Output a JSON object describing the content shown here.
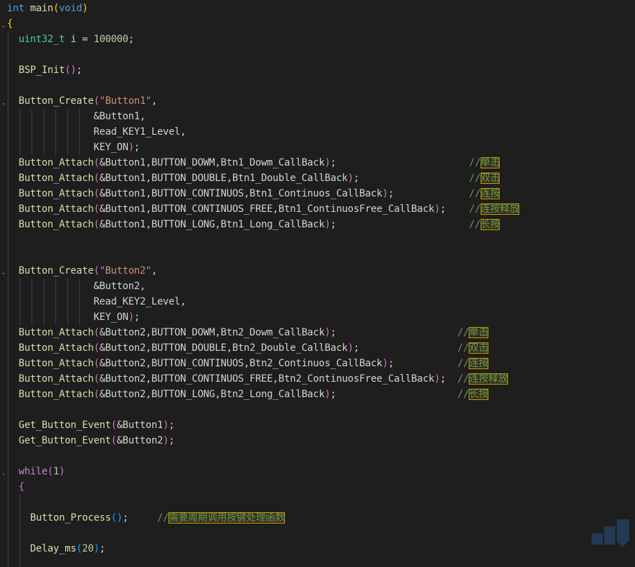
{
  "editor": {
    "language": "c",
    "theme": "dark",
    "colors": {
      "background": "#1e1e1e",
      "keyword": "#569cd6",
      "type": "#4ec9b0",
      "function": "#dcdcaa",
      "control": "#c586c0",
      "string": "#ce9178",
      "number": "#b5cea8",
      "variable": "#9cdcfe",
      "macro": "#4fc1ff",
      "comment": "#6a9955",
      "cjk_highlight_border": "#c8a000"
    },
    "lines": [
      {
        "id": "L1",
        "tokens": [
          {
            "t": "int",
            "c": "kw"
          },
          {
            "t": " ",
            "c": "punc"
          },
          {
            "t": "main",
            "c": "fn"
          },
          {
            "t": "(",
            "c": "p1"
          },
          {
            "t": "void",
            "c": "kw"
          },
          {
            "t": ")",
            "c": "p1"
          }
        ]
      },
      {
        "id": "L2",
        "tokens": [
          {
            "t": "{",
            "c": "p1"
          }
        ]
      },
      {
        "id": "L3",
        "tokens": [
          {
            "t": "  ",
            "c": "punc"
          },
          {
            "t": "uint32_t",
            "c": "ty"
          },
          {
            "t": " ",
            "c": "punc"
          },
          {
            "t": "i",
            "c": "var"
          },
          {
            "t": " = ",
            "c": "punc"
          },
          {
            "t": "100000",
            "c": "num"
          },
          {
            "t": ";",
            "c": "punc"
          }
        ]
      },
      {
        "id": "L4",
        "tokens": []
      },
      {
        "id": "L5",
        "tokens": [
          {
            "t": "  ",
            "c": "punc"
          },
          {
            "t": "BSP_Init",
            "c": "fn"
          },
          {
            "t": "()",
            "c": "p2"
          },
          {
            "t": ";",
            "c": "punc"
          }
        ]
      },
      {
        "id": "L6",
        "tokens": []
      },
      {
        "id": "L7",
        "tokens": [
          {
            "t": "  ",
            "c": "punc"
          },
          {
            "t": "Button_Create",
            "c": "fn"
          },
          {
            "t": "(",
            "c": "p2"
          },
          {
            "t": "\"Button1\"",
            "c": "str"
          },
          {
            "t": ",",
            "c": "punc"
          }
        ]
      },
      {
        "id": "L8",
        "tokens": [
          {
            "t": "               &Button1,",
            "c": "punc"
          }
        ]
      },
      {
        "id": "L9",
        "tokens": [
          {
            "t": "               Read_KEY1_Level,",
            "c": "punc"
          }
        ]
      },
      {
        "id": "L10",
        "tokens": [
          {
            "t": "               KEY_ON",
            "c": "punc"
          },
          {
            "t": ")",
            "c": "p2"
          },
          {
            "t": ";",
            "c": "punc"
          }
        ]
      },
      {
        "id": "L11",
        "tokens": [
          {
            "t": "  ",
            "c": "punc"
          },
          {
            "t": "Button_Attach",
            "c": "fn"
          },
          {
            "t": "(",
            "c": "p2"
          },
          {
            "t": "&Button1,BUTTON_DOWM,Btn1_Dowm_CallBack",
            "c": "punc"
          },
          {
            "t": ")",
            "c": "p2"
          },
          {
            "t": ";",
            "c": "punc"
          },
          {
            "t": "                       ",
            "c": "punc"
          },
          {
            "t": "//",
            "c": "cmt"
          },
          {
            "t": "单击",
            "c": "cjk"
          }
        ]
      },
      {
        "id": "L12",
        "tokens": [
          {
            "t": "  ",
            "c": "punc"
          },
          {
            "t": "Button_Attach",
            "c": "fn"
          },
          {
            "t": "(",
            "c": "p2"
          },
          {
            "t": "&Button1,BUTTON_DOUBLE,Btn1_Double_CallBack",
            "c": "punc"
          },
          {
            "t": ")",
            "c": "p2"
          },
          {
            "t": ";",
            "c": "punc"
          },
          {
            "t": "                   ",
            "c": "punc"
          },
          {
            "t": "//",
            "c": "cmt"
          },
          {
            "t": "双击",
            "c": "cjk"
          }
        ]
      },
      {
        "id": "L13",
        "tokens": [
          {
            "t": "  ",
            "c": "punc"
          },
          {
            "t": "Button_Attach",
            "c": "fn"
          },
          {
            "t": "(",
            "c": "p2"
          },
          {
            "t": "&Button1,BUTTON_CONTINUOS,Btn1_Continuos_CallBack",
            "c": "punc"
          },
          {
            "t": ")",
            "c": "p2"
          },
          {
            "t": ";",
            "c": "punc"
          },
          {
            "t": "             ",
            "c": "punc"
          },
          {
            "t": "//",
            "c": "cmt"
          },
          {
            "t": "连按",
            "c": "cjk"
          }
        ]
      },
      {
        "id": "L14",
        "tokens": [
          {
            "t": "  ",
            "c": "punc"
          },
          {
            "t": "Button_Attach",
            "c": "fn"
          },
          {
            "t": "(",
            "c": "p2"
          },
          {
            "t": "&Button1,BUTTON_CONTINUOS_FREE,Btn1_ContinuosFree_CallBack",
            "c": "punc"
          },
          {
            "t": ")",
            "c": "p2"
          },
          {
            "t": ";",
            "c": "punc"
          },
          {
            "t": "    ",
            "c": "punc"
          },
          {
            "t": "//",
            "c": "cmt"
          },
          {
            "t": "连按释放",
            "c": "cjk"
          }
        ]
      },
      {
        "id": "L15",
        "tokens": [
          {
            "t": "  ",
            "c": "punc"
          },
          {
            "t": "Button_Attach",
            "c": "fn"
          },
          {
            "t": "(",
            "c": "p2"
          },
          {
            "t": "&Button1,BUTTON_LONG,Btn1_Long_CallBack",
            "c": "punc"
          },
          {
            "t": ")",
            "c": "p2"
          },
          {
            "t": ";",
            "c": "punc"
          },
          {
            "t": "                       ",
            "c": "punc"
          },
          {
            "t": "//",
            "c": "cmt"
          },
          {
            "t": "长按",
            "c": "cjk"
          }
        ]
      },
      {
        "id": "L16",
        "tokens": []
      },
      {
        "id": "L17",
        "tokens": []
      },
      {
        "id": "L18",
        "tokens": [
          {
            "t": "  ",
            "c": "punc"
          },
          {
            "t": "Button_Create",
            "c": "fn"
          },
          {
            "t": "(",
            "c": "p2"
          },
          {
            "t": "\"Button2\"",
            "c": "str"
          },
          {
            "t": ",",
            "c": "punc"
          }
        ]
      },
      {
        "id": "L19",
        "tokens": [
          {
            "t": "               &Button2,",
            "c": "punc"
          }
        ]
      },
      {
        "id": "L20",
        "tokens": [
          {
            "t": "               Read_KEY2_Level,",
            "c": "punc"
          }
        ]
      },
      {
        "id": "L21",
        "tokens": [
          {
            "t": "               KEY_ON",
            "c": "punc"
          },
          {
            "t": ")",
            "c": "p2"
          },
          {
            "t": ";",
            "c": "punc"
          }
        ]
      },
      {
        "id": "L22",
        "tokens": [
          {
            "t": "  ",
            "c": "punc"
          },
          {
            "t": "Button_Attach",
            "c": "fn"
          },
          {
            "t": "(",
            "c": "p2"
          },
          {
            "t": "&Button2,BUTTON_DOWM,Btn2_Dowm_CallBack",
            "c": "punc"
          },
          {
            "t": ")",
            "c": "p2"
          },
          {
            "t": ";",
            "c": "punc"
          },
          {
            "t": "                     ",
            "c": "punc"
          },
          {
            "t": "//",
            "c": "cmt"
          },
          {
            "t": "单击",
            "c": "cjk"
          }
        ]
      },
      {
        "id": "L23",
        "tokens": [
          {
            "t": "  ",
            "c": "punc"
          },
          {
            "t": "Button_Attach",
            "c": "fn"
          },
          {
            "t": "(",
            "c": "p2"
          },
          {
            "t": "&Button2,BUTTON_DOUBLE,Btn2_Double_CallBack",
            "c": "punc"
          },
          {
            "t": ")",
            "c": "p2"
          },
          {
            "t": ";",
            "c": "punc"
          },
          {
            "t": "                 ",
            "c": "punc"
          },
          {
            "t": "//",
            "c": "cmt"
          },
          {
            "t": "双击",
            "c": "cjk"
          }
        ]
      },
      {
        "id": "L24",
        "tokens": [
          {
            "t": "  ",
            "c": "punc"
          },
          {
            "t": "Button_Attach",
            "c": "fn"
          },
          {
            "t": "(",
            "c": "p2"
          },
          {
            "t": "&Button2,BUTTON_CONTINUOS,Btn2_Continuos_CallBack",
            "c": "punc"
          },
          {
            "t": ")",
            "c": "p2"
          },
          {
            "t": ";",
            "c": "punc"
          },
          {
            "t": "           ",
            "c": "punc"
          },
          {
            "t": "//",
            "c": "cmt"
          },
          {
            "t": "连按",
            "c": "cjk"
          }
        ]
      },
      {
        "id": "L25",
        "tokens": [
          {
            "t": "  ",
            "c": "punc"
          },
          {
            "t": "Button_Attach",
            "c": "fn"
          },
          {
            "t": "(",
            "c": "p2"
          },
          {
            "t": "&Button2,BUTTON_CONTINUOS_FREE,Btn2_ContinuosFree_CallBack",
            "c": "punc"
          },
          {
            "t": ")",
            "c": "p2"
          },
          {
            "t": ";",
            "c": "punc"
          },
          {
            "t": "  ",
            "c": "punc"
          },
          {
            "t": "//",
            "c": "cmt"
          },
          {
            "t": "连按释放",
            "c": "cjk"
          }
        ]
      },
      {
        "id": "L26",
        "tokens": [
          {
            "t": "  ",
            "c": "punc"
          },
          {
            "t": "Button_Attach",
            "c": "fn"
          },
          {
            "t": "(",
            "c": "p2"
          },
          {
            "t": "&Button2,BUTTON_LONG,Btn2_Long_CallBack",
            "c": "punc"
          },
          {
            "t": ")",
            "c": "p2"
          },
          {
            "t": ";",
            "c": "punc"
          },
          {
            "t": "                     ",
            "c": "punc"
          },
          {
            "t": "//",
            "c": "cmt"
          },
          {
            "t": "长按",
            "c": "cjk"
          }
        ]
      },
      {
        "id": "L27",
        "tokens": []
      },
      {
        "id": "L28",
        "tokens": [
          {
            "t": "  ",
            "c": "punc"
          },
          {
            "t": "Get_Button_Event",
            "c": "fn"
          },
          {
            "t": "(",
            "c": "p2"
          },
          {
            "t": "&Button1",
            "c": "punc"
          },
          {
            "t": ")",
            "c": "p2"
          },
          {
            "t": ";",
            "c": "punc"
          }
        ]
      },
      {
        "id": "L29",
        "tokens": [
          {
            "t": "  ",
            "c": "punc"
          },
          {
            "t": "Get_Button_Event",
            "c": "fn"
          },
          {
            "t": "(",
            "c": "p2"
          },
          {
            "t": "&Button2",
            "c": "punc"
          },
          {
            "t": ")",
            "c": "p2"
          },
          {
            "t": ";",
            "c": "punc"
          }
        ]
      },
      {
        "id": "L30",
        "tokens": []
      },
      {
        "id": "L31",
        "tokens": [
          {
            "t": "  ",
            "c": "punc"
          },
          {
            "t": "while",
            "c": "ctl"
          },
          {
            "t": "(",
            "c": "p2"
          },
          {
            "t": "1",
            "c": "num"
          },
          {
            "t": ")",
            "c": "p2"
          }
        ]
      },
      {
        "id": "L32",
        "tokens": [
          {
            "t": "  ",
            "c": "punc"
          },
          {
            "t": "{",
            "c": "p2"
          }
        ]
      },
      {
        "id": "L33",
        "tokens": []
      },
      {
        "id": "L34",
        "tokens": [
          {
            "t": "    ",
            "c": "punc"
          },
          {
            "t": "Button_Process",
            "c": "fn"
          },
          {
            "t": "()",
            "c": "p3"
          },
          {
            "t": ";",
            "c": "punc"
          },
          {
            "t": "     ",
            "c": "punc"
          },
          {
            "t": "//",
            "c": "cmt"
          },
          {
            "t": "需要周期调用按键处理函数",
            "c": "cjk"
          }
        ]
      },
      {
        "id": "L35",
        "tokens": []
      },
      {
        "id": "L36",
        "tokens": [
          {
            "t": "    ",
            "c": "punc"
          },
          {
            "t": "Delay_ms",
            "c": "fn"
          },
          {
            "t": "(",
            "c": "p3"
          },
          {
            "t": "20",
            "c": "num"
          },
          {
            "t": ")",
            "c": "p3"
          },
          {
            "t": ";",
            "c": "punc"
          }
        ]
      }
    ]
  },
  "watermark": {
    "icon": "wifi-logo-icon"
  }
}
